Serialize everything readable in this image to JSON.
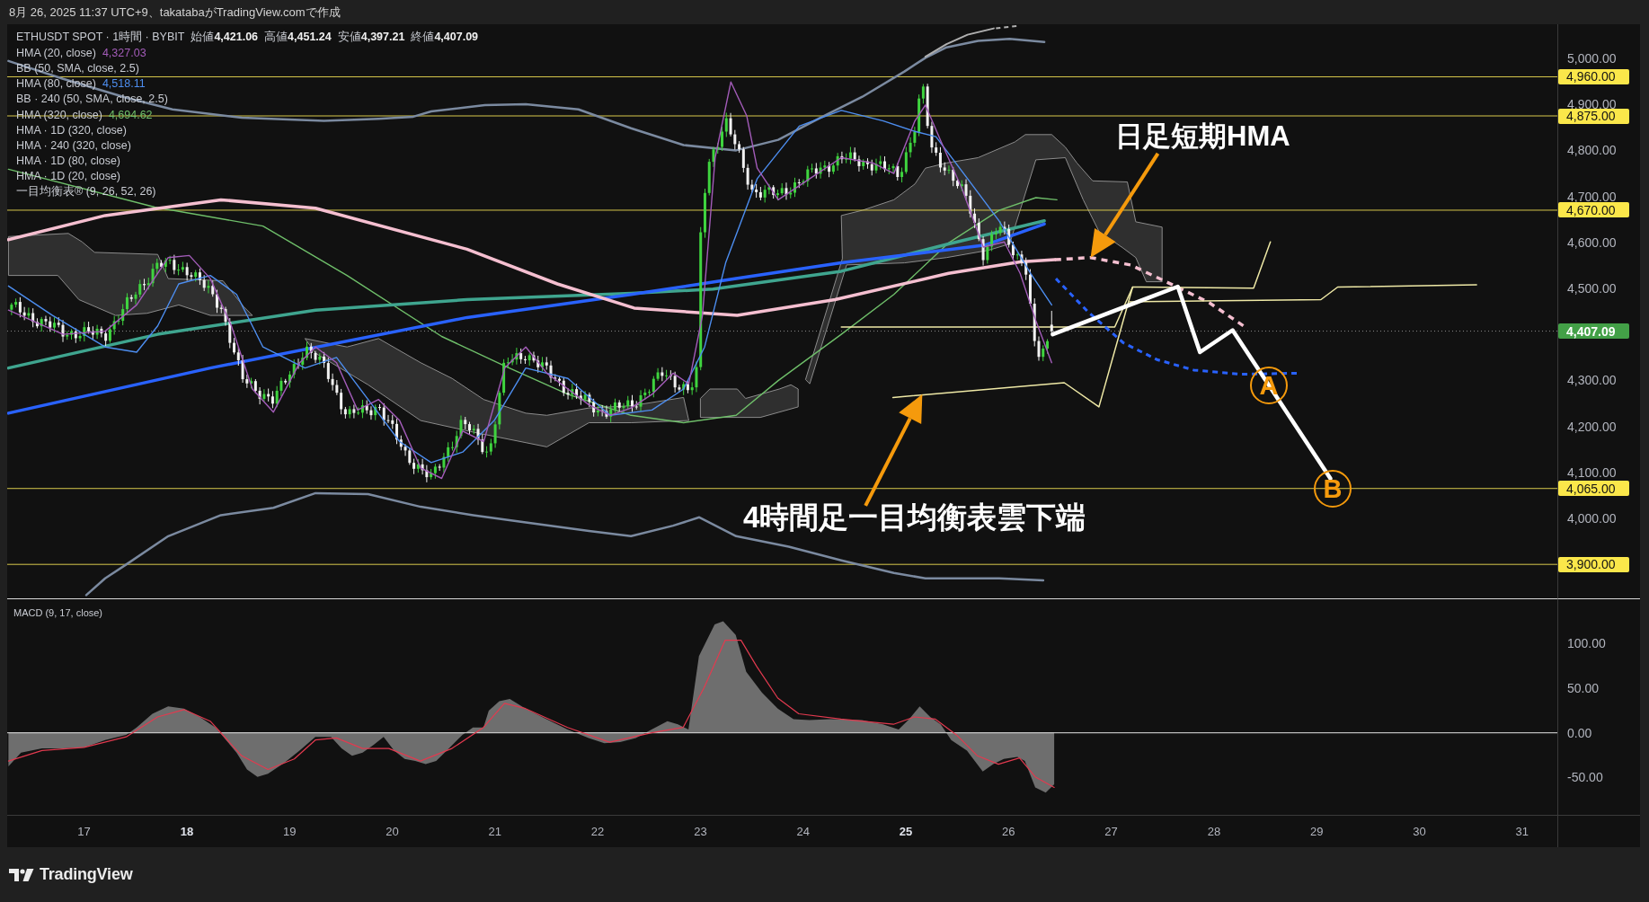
{
  "caption": "8月 26, 2025 11:37 UTC+9、takatabaがTradingView.comで作成",
  "legend": {
    "symbol": "ETHUSDT SPOT · 1時間 · BYBIT",
    "ohlc": [
      "始値**4,421.06**",
      "高値**4,451.24**",
      "安値**4,397.21**",
      "終値**4,407.09**"
    ],
    "indicators": [
      {
        "name": "HMA (20, close)",
        "value": "4,327.03",
        "color": "#a35cb9"
      },
      {
        "name": "BB (50, SMA, close, 2.5)"
      },
      {
        "name": "HMA (80, close)",
        "value": "4,518.11",
        "color": "#4d8ef0"
      },
      {
        "name": "BB · 240 (50, SMA, close, 2.5)"
      },
      {
        "name": "HMA (320, close)",
        "value": "4,694.62",
        "color": "#6fbf6a"
      },
      {
        "name": "HMA · 1D (320, close)"
      },
      {
        "name": "HMA · 240 (320, close)"
      },
      {
        "name": "HMA · 1D (80, close)"
      },
      {
        "name": "HMA · 1D (20, close)"
      },
      {
        "name": "一目均衡表® (9, 26, 52, 26)"
      }
    ]
  },
  "annotations": [
    {
      "kind": "callout",
      "text": "日足短期HMA"
    },
    {
      "kind": "callout",
      "text": "4時間足一目均衡表雲下端"
    },
    {
      "kind": "point",
      "text": "A"
    },
    {
      "kind": "point",
      "text": "B"
    }
  ],
  "price_axis": {
    "ticks": [
      "5,000.00",
      "4,900.00",
      "4,800.00",
      "4,700.00",
      "4,600.00",
      "4,500.00",
      "4,300.00",
      "4,200.00",
      "4,100.00",
      "4,000.00"
    ],
    "levels": [
      {
        "kind": "level",
        "text": "4,960.00"
      },
      {
        "kind": "level",
        "text": "4,875.00"
      },
      {
        "kind": "level",
        "text": "4,670.00"
      },
      {
        "kind": "last",
        "text": "4,407.09"
      },
      {
        "kind": "level",
        "text": "4,065.00"
      },
      {
        "kind": "level",
        "text": "3,900.00"
      }
    ]
  },
  "macd": {
    "title": "MACD (9, 17, close)",
    "ticks": [
      "100.00",
      "50.00",
      "0.00",
      "-50.00"
    ]
  },
  "time_axis": [
    {
      "label": "17",
      "bold": false
    },
    {
      "label": "18",
      "bold": true
    },
    {
      "label": "19",
      "bold": false
    },
    {
      "label": "20",
      "bold": false
    },
    {
      "label": "21",
      "bold": false
    },
    {
      "label": "22",
      "bold": false
    },
    {
      "label": "23",
      "bold": false
    },
    {
      "label": "24",
      "bold": false
    },
    {
      "label": "25",
      "bold": true
    },
    {
      "label": "26",
      "bold": false
    },
    {
      "label": "27",
      "bold": false
    },
    {
      "label": "28",
      "bold": false
    },
    {
      "label": "29",
      "bold": false
    },
    {
      "label": "30",
      "bold": false
    },
    {
      "label": "31",
      "bold": false
    }
  ],
  "footer": {
    "brand": "TradingView"
  }
}
